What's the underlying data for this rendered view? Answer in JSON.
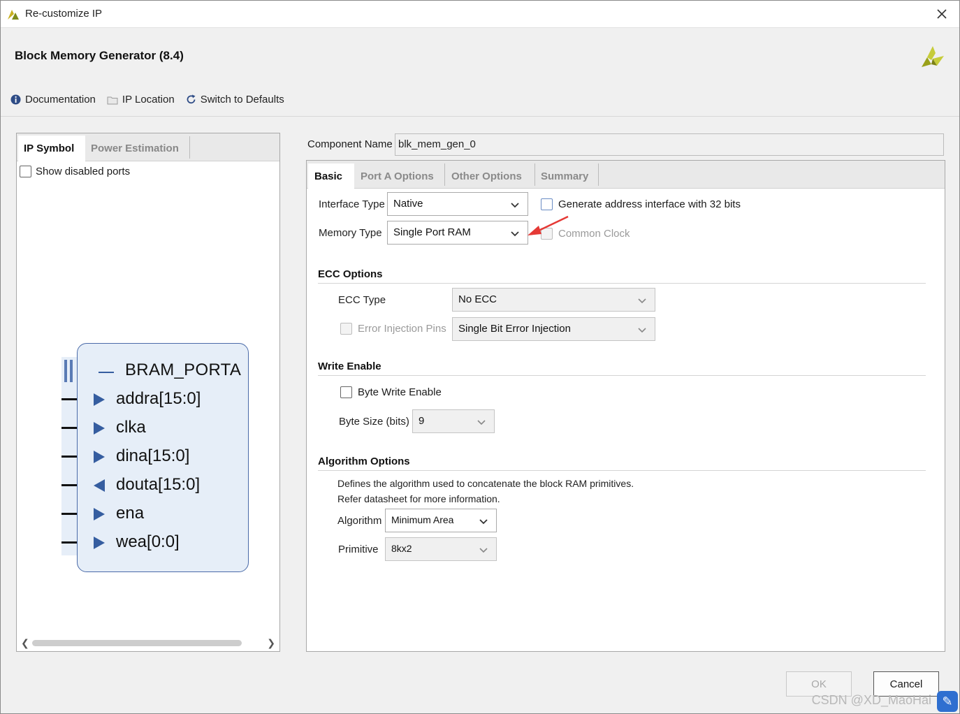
{
  "window": {
    "title": "Re-customize IP"
  },
  "header": {
    "heading": "Block Memory Generator (8.4)"
  },
  "toolbar": {
    "documentation": "Documentation",
    "ip_location": "IP Location",
    "switch_defaults": "Switch to Defaults"
  },
  "left_panel": {
    "tabs": [
      "IP Symbol",
      "Power Estimation"
    ],
    "show_disabled_ports": "Show disabled ports",
    "symbol": {
      "bus": "BRAM_PORTA",
      "ports": [
        {
          "name": "addra[15:0]",
          "direction": "in"
        },
        {
          "name": "clka",
          "direction": "in"
        },
        {
          "name": "dina[15:0]",
          "direction": "in"
        },
        {
          "name": "douta[15:0]",
          "direction": "out"
        },
        {
          "name": "ena",
          "direction": "in"
        },
        {
          "name": "wea[0:0]",
          "direction": "in"
        }
      ]
    }
  },
  "component": {
    "label": "Component Name",
    "value": "blk_mem_gen_0"
  },
  "tabs": [
    "Basic",
    "Port A Options",
    "Other Options",
    "Summary"
  ],
  "basic": {
    "interface_type_label": "Interface Type",
    "interface_type_value": "Native",
    "gen_addr_32": "Generate address interface with 32 bits",
    "memory_type_label": "Memory Type",
    "memory_type_value": "Single Port RAM",
    "common_clock": "Common Clock",
    "ecc": {
      "title": "ECC Options",
      "type_label": "ECC Type",
      "type_value": "No ECC",
      "error_pins": "Error Injection Pins",
      "error_value": "Single Bit Error Injection"
    },
    "write_enable": {
      "title": "Write Enable",
      "byte_write": "Byte Write Enable",
      "byte_size_label": "Byte Size (bits)",
      "byte_size_value": "9"
    },
    "algorithm": {
      "title": "Algorithm Options",
      "desc1": "Defines the algorithm used to concatenate the block RAM primitives.",
      "desc2": "Refer datasheet for more information.",
      "algorithm_label": "Algorithm",
      "algorithm_value": "Minimum Area",
      "primitive_label": "Primitive",
      "primitive_value": "8kx2"
    }
  },
  "footer": {
    "ok": "OK",
    "cancel": "Cancel",
    "watermark": "CSDN @XD_MaoHai"
  },
  "colors": {
    "symbol_fill": "#e6eef8",
    "symbol_border": "#4a6aa8",
    "port_arrow": "#355da0",
    "annotation_arrow": "#e53935",
    "logo_yellow": "#b9c21e"
  }
}
